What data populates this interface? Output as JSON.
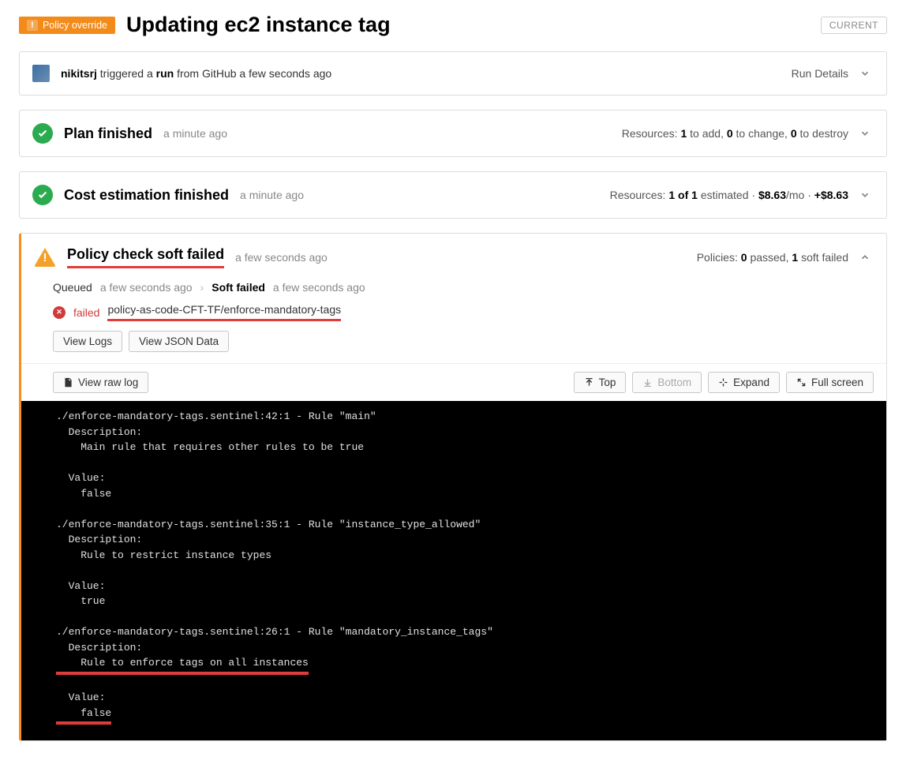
{
  "header": {
    "override_badge": "Policy override",
    "title": "Updating ec2 instance tag",
    "current_badge": "CURRENT"
  },
  "trigger": {
    "user": "nikitsrj",
    "triggered_a": "triggered a",
    "run": "run",
    "from": "from GitHub a few seconds ago",
    "run_details": "Run Details"
  },
  "plan": {
    "title": "Plan finished",
    "ts": "a minute ago",
    "res_label": "Resources:",
    "to_add_n": "1",
    "to_add": "to add,",
    "to_change_n": "0",
    "to_change": "to change,",
    "to_destroy_n": "0",
    "to_destroy": "to destroy"
  },
  "cost": {
    "title": "Cost estimation finished",
    "ts": "a minute ago",
    "res_label": "Resources:",
    "est": "1 of 1",
    "est_label": "estimated ·",
    "amt": "$8.63",
    "per": "/mo ·",
    "delta": "+$8.63"
  },
  "policy": {
    "title": "Policy check soft failed",
    "ts": "a few seconds ago",
    "summ_label": "Policies:",
    "passed_n": "0",
    "passed": "passed,",
    "sf_n": "1",
    "sf": "soft failed",
    "queued": "Queued",
    "queued_ts": "a few seconds ago",
    "soft_failed": "Soft failed",
    "soft_failed_ts": "a few seconds ago",
    "failed": "failed",
    "policy_name": "policy-as-code-CFT-TF/enforce-mandatory-tags",
    "view_logs": "View Logs",
    "view_json": "View JSON Data"
  },
  "log_toolbar": {
    "view_raw": "View raw log",
    "top": "Top",
    "bottom": "Bottom",
    "expand": "Expand",
    "fullscreen": "Full screen"
  },
  "logs": {
    "l0": "./enforce-mandatory-tags.sentinel:42:1 - Rule \"main\"",
    "l1": "  Description:",
    "l2": "    Main rule that requires other rules to be true",
    "l3": "",
    "l4": "  Value:",
    "l5": "    false",
    "l6": "",
    "l7": "./enforce-mandatory-tags.sentinel:35:1 - Rule \"instance_type_allowed\"",
    "l8": "  Description:",
    "l9": "    Rule to restrict instance types",
    "l10": "",
    "l11": "  Value:",
    "l12": "    true",
    "l13": "",
    "l14": "./enforce-mandatory-tags.sentinel:26:1 - Rule \"mandatory_instance_tags\"",
    "l15": "  Description:",
    "l16": "    Rule to enforce tags on all instances",
    "l17": "",
    "l18": "  Value:",
    "l19": "    false"
  }
}
